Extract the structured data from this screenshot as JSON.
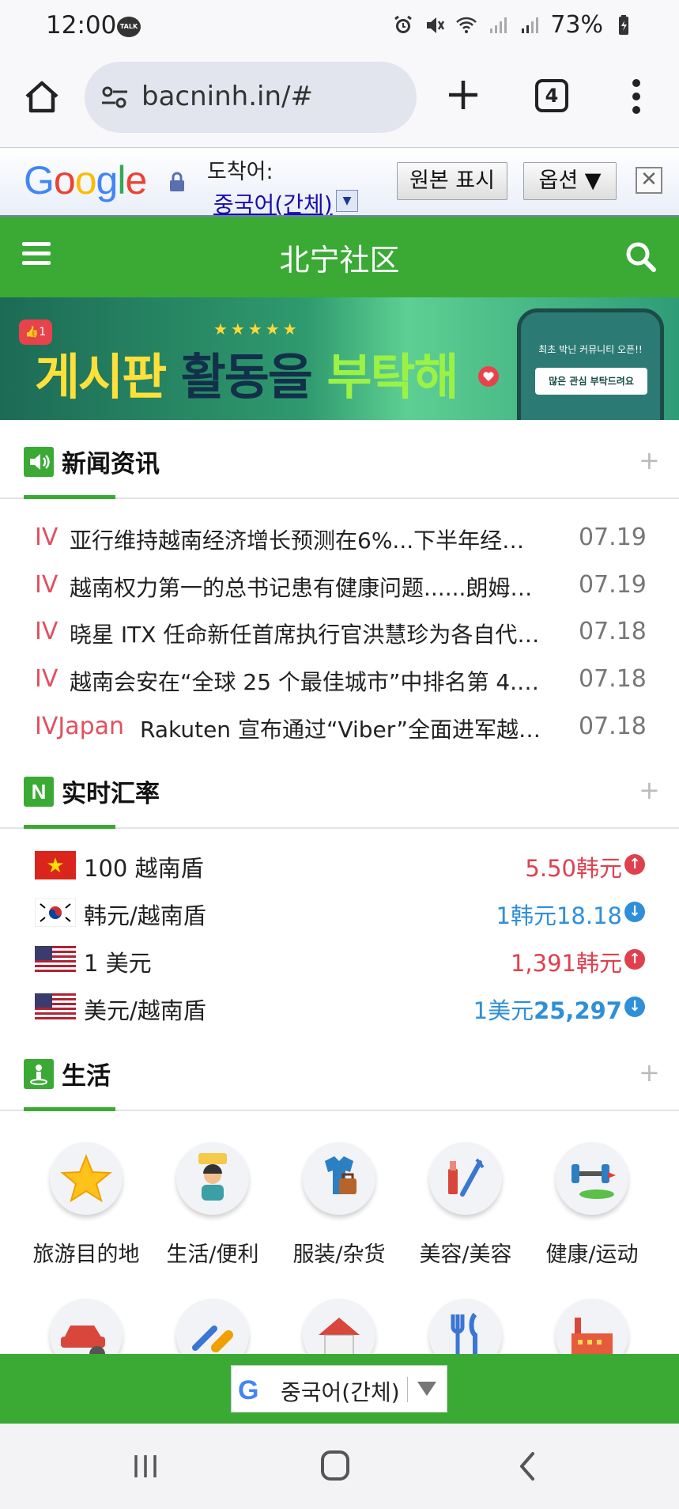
{
  "status": {
    "time": "12:00",
    "talk": "TALK",
    "battery": "73%"
  },
  "browser": {
    "url": "bacninh.in/#",
    "tab_count": "4"
  },
  "translate_bar": {
    "logo": "Google",
    "to_label": "도착어:",
    "language": "중국어(간체)",
    "dropdown_glyph": "▼",
    "show_original": "원본 표시",
    "options": "옵션 ▼",
    "close": "✕"
  },
  "site": {
    "title": "北宁社区"
  },
  "banner": {
    "stars": "★★★★★",
    "like": "👍1",
    "text_part1": "게시판 ",
    "text_part2": "활동을 ",
    "text_part3": "부탁해",
    "phone_text": "최초 박닌 커뮤니티 오픈!!",
    "phone_button": "많은 관심 부탁드려요"
  },
  "news": {
    "title": "新闻资讯",
    "plus": "+",
    "items": [
      {
        "tag": "IV",
        "title": "亚行维持越南经济增长预测在6%...下半年经…",
        "date": "07.19"
      },
      {
        "tag": "IV",
        "title": "越南权力第一的总书记患有健康问题......朗姆…",
        "date": "07.19"
      },
      {
        "tag": "IV",
        "title": "晓星 ITX 任命新任首席执行官洪慧珍为各自代…",
        "date": "07.18"
      },
      {
        "tag": "IV",
        "title": "越南会安在“全球 25 个最佳城市”中排名第 4.…",
        "date": "07.18"
      },
      {
        "tag": "IVJapan",
        "title": "Rakuten 宣布通过“Viber”全面进军越…",
        "date": "07.18"
      }
    ]
  },
  "rates": {
    "title": "实时汇率",
    "icon_letter": "N",
    "plus": "+",
    "items": [
      {
        "label": "100 越南盾",
        "value": "5.50韩元",
        "direction": "up",
        "flag": "vietnam"
      },
      {
        "label": "韩元/越南盾",
        "value": "1韩元18.18",
        "direction": "down",
        "flag": "korea"
      },
      {
        "label": "1 美元",
        "value": "1,391韩元",
        "direction": "up",
        "flag": "usa"
      },
      {
        "label": "美元/越南盾",
        "value_prefix": "1美元",
        "value_bold": "25,297",
        "direction": "down",
        "flag": "usa"
      }
    ]
  },
  "life": {
    "title": "生活",
    "plus": "+",
    "items": [
      {
        "label": "旅游目的地",
        "icon": "star-icon"
      },
      {
        "label": "生活/便利",
        "icon": "person-icon"
      },
      {
        "label": "服装/杂货",
        "icon": "clothes-icon"
      },
      {
        "label": "美容/美容",
        "icon": "beauty-icon"
      },
      {
        "label": "健康/运动",
        "icon": "dumbbell-icon"
      }
    ],
    "row2_icons": [
      "car-icon",
      "pill-icon",
      "house-icon",
      "utensils-icon",
      "factory-icon"
    ]
  },
  "bottom_translate": {
    "g": "G",
    "language": "중국어(간체)"
  },
  "colors": {
    "brand_green": "#3aaa35",
    "up_red": "#e0404e",
    "down_blue": "#2f8fd8",
    "news_tag_red": "#e0515f"
  }
}
